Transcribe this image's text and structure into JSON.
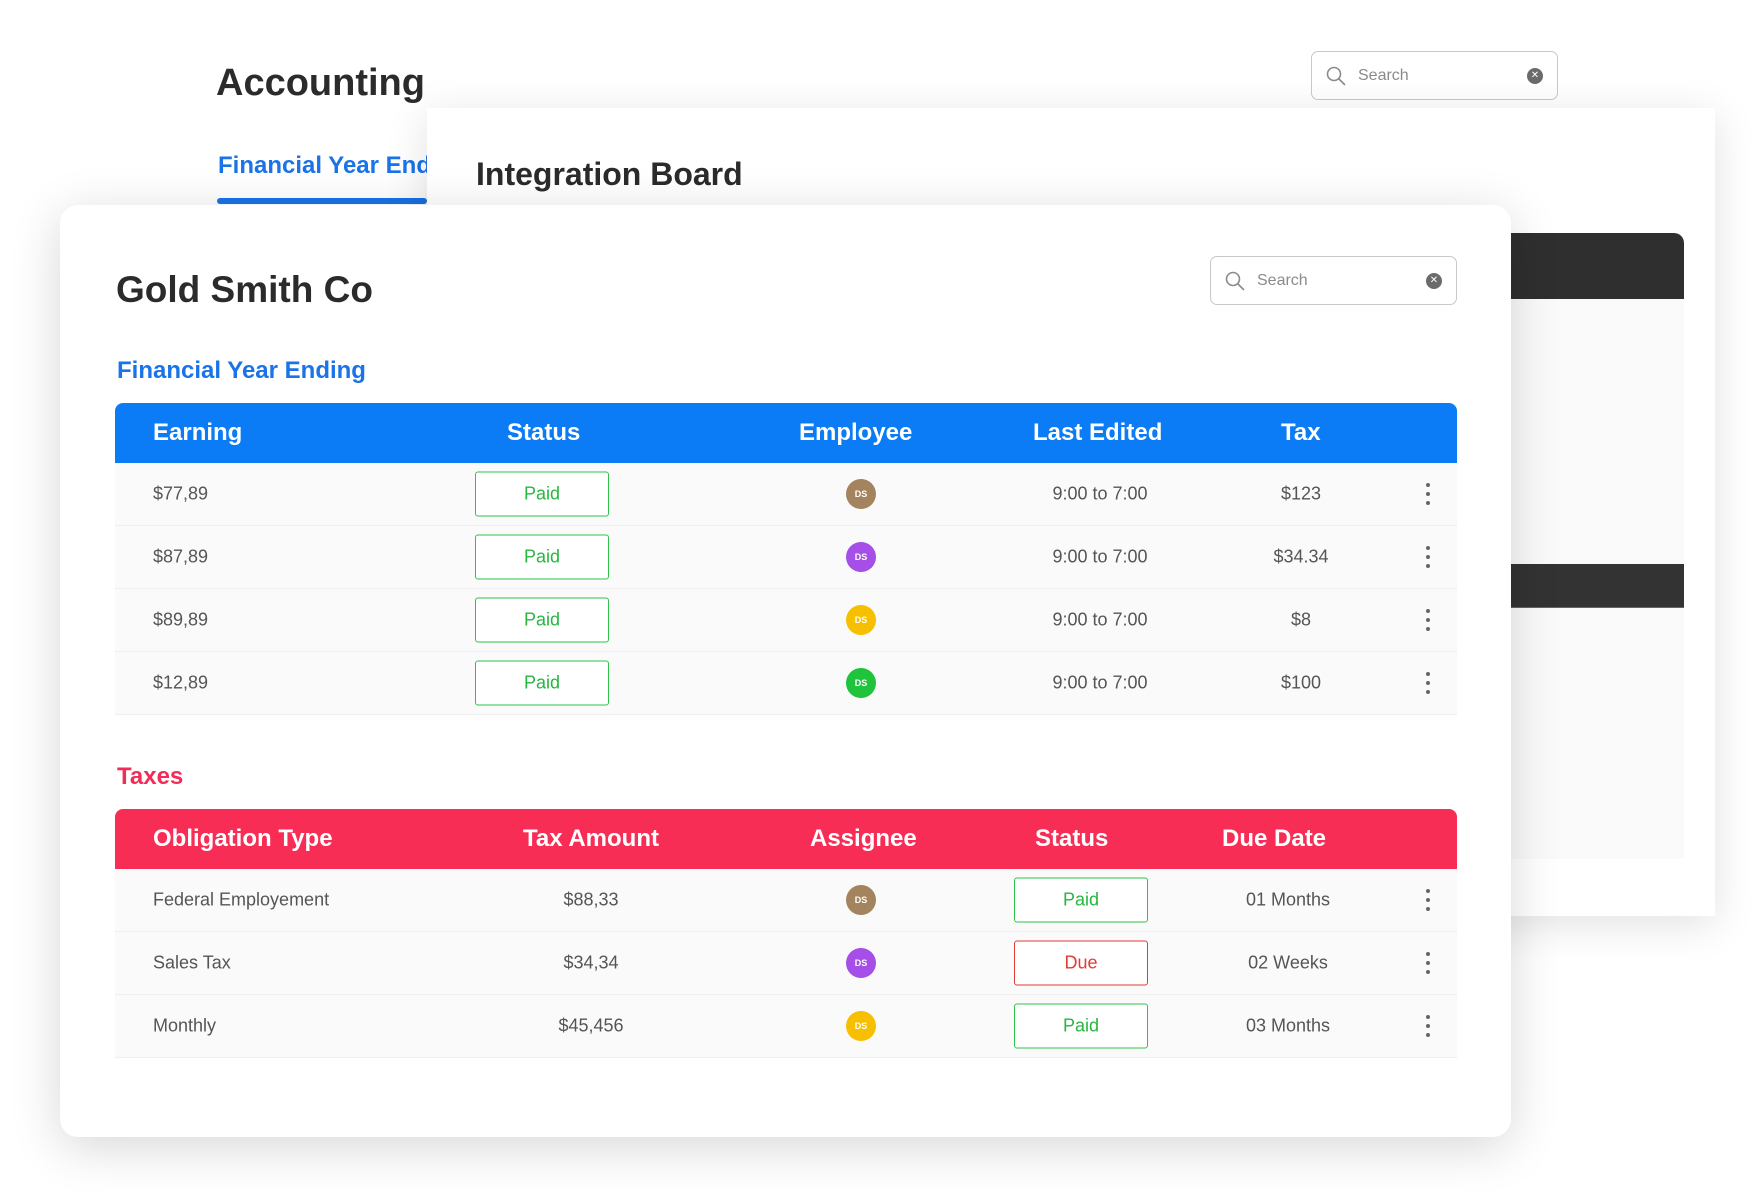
{
  "background": {
    "title": "Accounting",
    "tab_label": "Financial Year Endi",
    "search": {
      "placeholder": "Search"
    }
  },
  "middle": {
    "title": "Integration Board"
  },
  "card": {
    "title": "Gold Smith Co",
    "search": {
      "placeholder": "Search"
    },
    "financial": {
      "label": "Financial Year Ending",
      "headers": [
        "Earning",
        "Status",
        "Employee",
        "Last Edited",
        "Tax"
      ],
      "rows": [
        {
          "earning": "$77,89",
          "status": "Paid",
          "employee": "DS",
          "color": "#a3845e",
          "last_edited": "9:00 to 7:00",
          "tax": "$123"
        },
        {
          "earning": "$87,89",
          "status": "Paid",
          "employee": "DS",
          "color": "#a64ee8",
          "last_edited": "9:00 to 7:00",
          "tax": "$34.34"
        },
        {
          "earning": "$89,89",
          "status": "Paid",
          "employee": "DS",
          "color": "#f6c000",
          "last_edited": "9:00 to 7:00",
          "tax": "$8"
        },
        {
          "earning": "$12,89",
          "status": "Paid",
          "employee": "DS",
          "color": "#1fc33c",
          "last_edited": "9:00 to 7:00",
          "tax": "$100"
        }
      ]
    },
    "taxes": {
      "label": "Taxes",
      "headers": [
        "Obligation Type",
        "Tax Amount",
        "Assignee",
        "Status",
        "Due Date"
      ],
      "rows": [
        {
          "type": "Federal Employement",
          "amount": "$88,33",
          "assignee": "DS",
          "color": "#a3845e",
          "status": "Paid",
          "due": "01 Months"
        },
        {
          "type": "Sales Tax",
          "amount": "$34,34",
          "assignee": "DS",
          "color": "#a64ee8",
          "status": "Due",
          "due": "02 Weeks"
        },
        {
          "type": "Monthly",
          "amount": "$45,456",
          "assignee": "DS",
          "color": "#f6c000",
          "status": "Paid",
          "due": "03 Months"
        }
      ]
    }
  }
}
